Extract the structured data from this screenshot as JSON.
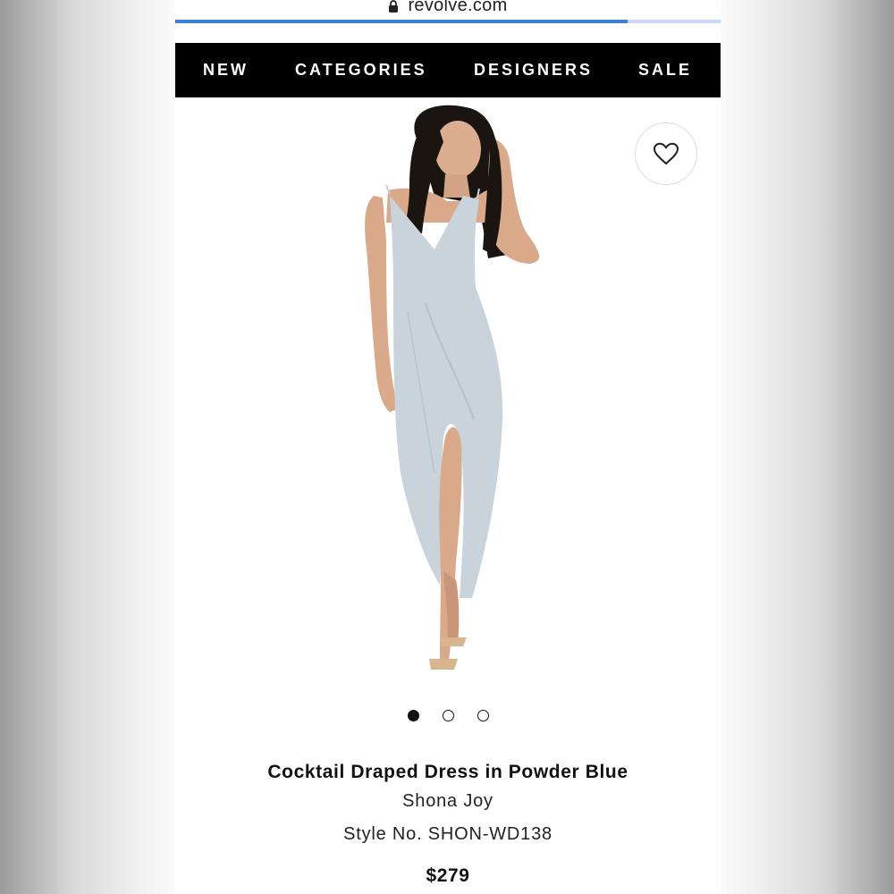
{
  "browser": {
    "url": "revolve.com",
    "lock_icon": "lock-icon",
    "load_progress_percent": 83
  },
  "nav": {
    "items": [
      {
        "label": "NEW"
      },
      {
        "label": "CATEGORIES"
      },
      {
        "label": "DESIGNERS"
      },
      {
        "label": "SALE"
      }
    ]
  },
  "product": {
    "image": "model wearing powder blue draped slip dress",
    "wishlist_icon": "heart-icon",
    "carousel": {
      "count": 3,
      "active": 1
    },
    "title": "Cocktail Draped Dress in Powder Blue",
    "designer": "Shona Joy",
    "style_no": "Style No. SHON-WD138",
    "price": "$279"
  },
  "colors": {
    "nav_background": "#000000",
    "progress": "#3d7fd6",
    "dress": "#c9d3dc"
  }
}
